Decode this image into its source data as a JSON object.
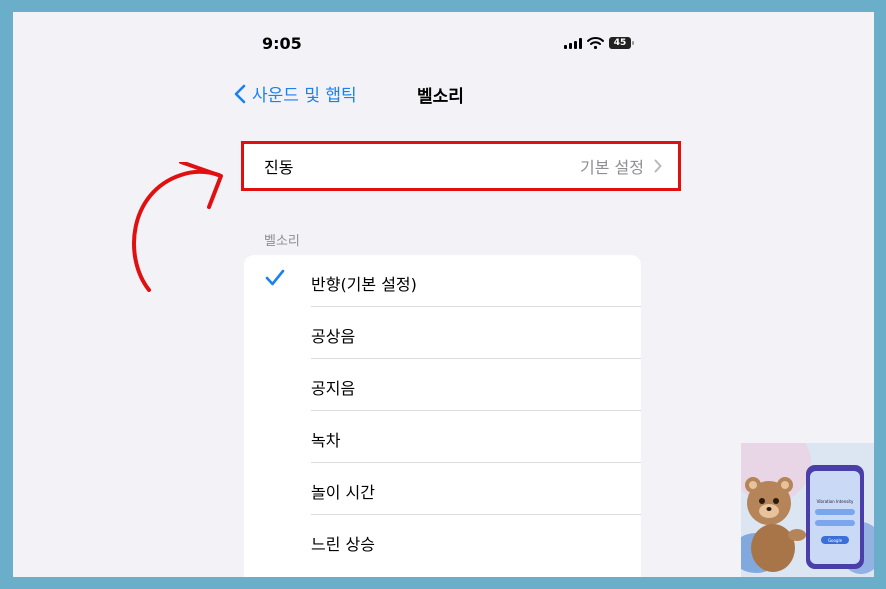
{
  "status_bar": {
    "time": "9:05",
    "battery": "45"
  },
  "nav": {
    "back_label": "사운드 및 햅틱",
    "title": "벨소리"
  },
  "vibration": {
    "label": "진동",
    "value": "기본 설정"
  },
  "ringtones": {
    "header": "벨소리",
    "items": [
      {
        "label": "반향(기본 설정)",
        "selected": true
      },
      {
        "label": "공상음",
        "selected": false
      },
      {
        "label": "공지음",
        "selected": false
      },
      {
        "label": "녹차",
        "selected": false
      },
      {
        "label": "놀이 시간",
        "selected": false
      },
      {
        "label": "느린 상승",
        "selected": false
      }
    ]
  },
  "thumbnail": {
    "phone_text": "Vibration Intensity",
    "button_text": "Google"
  },
  "colors": {
    "accent": "#1a82f0",
    "highlight": "#e01010",
    "border": "#6aaec9"
  }
}
